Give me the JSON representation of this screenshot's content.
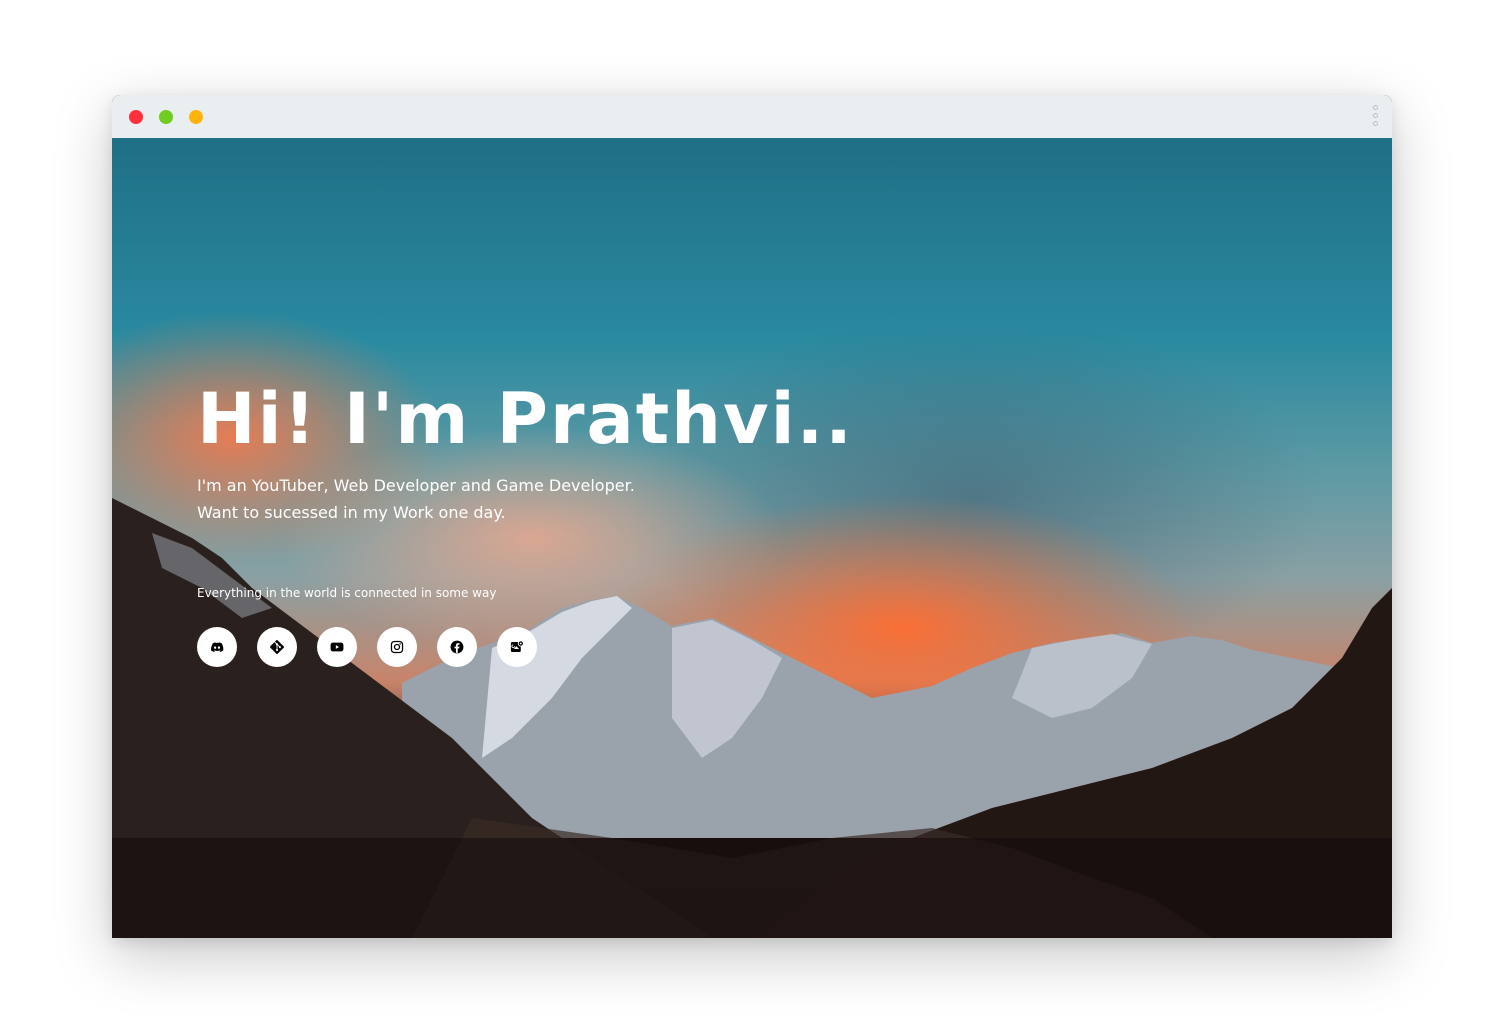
{
  "browser": {
    "traffic_lights": [
      "close",
      "zoom",
      "minimize"
    ],
    "menu_icon": "kebab-menu-icon"
  },
  "hero": {
    "headline": "Hi! I'm Prathvi..",
    "tagline_line1": "I'm an YouTuber, Web Developer and Game Developer.",
    "tagline_line2": "Want to sucessed in my Work one day.",
    "quote": "Everything in the world is connected in some way"
  },
  "social_links": [
    {
      "icon": "discord-icon"
    },
    {
      "icon": "git-icon"
    },
    {
      "icon": "youtube-icon"
    },
    {
      "icon": "instagram-icon"
    },
    {
      "icon": "facebook-icon"
    },
    {
      "icon": "google-maps-icon"
    }
  ],
  "colors": {
    "titlebar": "#e9eff0",
    "close": "#ff2f3b",
    "zoom": "#6fcd1f",
    "minimize": "#ffb40b",
    "text": "#ffffff",
    "social_bg": "#ffffff",
    "social_icon": "#000000"
  }
}
